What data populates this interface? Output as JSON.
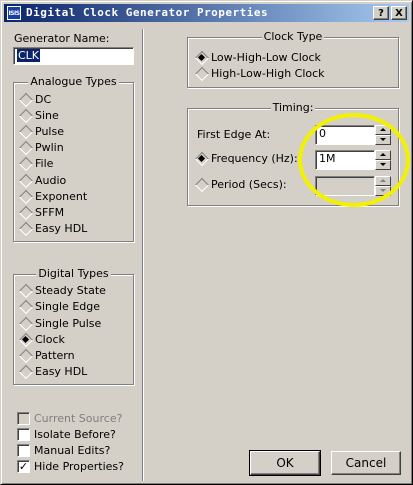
{
  "window": {
    "icon_text": "ISIS",
    "title": "Digital Clock Generator Properties",
    "help_btn": "?",
    "close_btn": "X"
  },
  "generator": {
    "label": "Generator Name:",
    "value": "CLK"
  },
  "analogue": {
    "title": "Analogue Types",
    "items": [
      "DC",
      "Sine",
      "Pulse",
      "Pwlin",
      "File",
      "Audio",
      "Exponent",
      "SFFM",
      "Easy HDL"
    ]
  },
  "digital": {
    "title": "Digital Types",
    "items": [
      "Steady State",
      "Single Edge",
      "Single Pulse",
      "Clock",
      "Pattern",
      "Easy HDL"
    ],
    "selected": "Clock"
  },
  "options": {
    "current_source": "Current Source?",
    "isolate_before": "Isolate Before?",
    "manual_edits": "Manual Edits?",
    "hide_properties": "Hide Properties?",
    "hide_properties_checked": true
  },
  "clock_type": {
    "title": "Clock Type",
    "options": [
      "Low-High-Low Clock",
      "High-Low-High Clock"
    ],
    "selected": "Low-High-Low Clock"
  },
  "timing": {
    "title": "Timing:",
    "first_edge_label": "First Edge At:",
    "first_edge_value": "0",
    "frequency_label": "Frequency (Hz):",
    "frequency_value": "1M",
    "period_label": "Period (Secs):",
    "period_value": "",
    "selected": "frequency"
  },
  "buttons": {
    "ok": "OK",
    "cancel": "Cancel"
  },
  "colors": {
    "highlight_ring": "#f2f200",
    "title_bar": "#0a246a"
  }
}
